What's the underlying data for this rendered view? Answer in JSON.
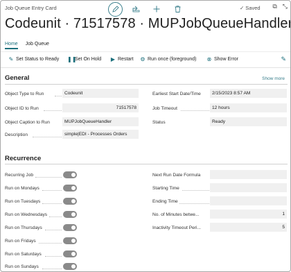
{
  "header": {
    "card_type": "Job Queue Entry Card",
    "title": "Codeunit · 71517578 · MUPJobQueueHandler",
    "saved_label": "Saved",
    "icons": [
      "edit-pencil-icon",
      "share-icon",
      "new-plus-icon",
      "delete-trash-icon",
      "checkmark-icon",
      "open-new-window-icon",
      "collapse-icon"
    ]
  },
  "tabs": [
    {
      "label": "Home",
      "active": true
    },
    {
      "label": "Job Queue",
      "active": false
    }
  ],
  "actions": [
    {
      "label": "Set Status to Ready",
      "icon": "set-status-icon"
    },
    {
      "label": "Set On Hold",
      "icon": "pause-icon"
    },
    {
      "label": "Restart",
      "icon": "play-icon"
    },
    {
      "label": "Run once (foreground)",
      "icon": "run-once-icon"
    },
    {
      "label": "Show Error",
      "icon": "error-icon"
    }
  ],
  "general": {
    "title": "General",
    "show_more": "Show more",
    "fields": [
      {
        "label": "Object Type to Run",
        "value": "Codeunit"
      },
      {
        "label": "Object ID to Run",
        "value": "71517578"
      },
      {
        "label": "Object Caption to Run",
        "value": "MUPJobQueueHandler"
      },
      {
        "label": "Description",
        "value": "simple|EDI - Processes Orders"
      },
      {
        "label": "Earliest Start Date/Time",
        "value": "2/15/2023 8:57 AM"
      },
      {
        "label": "Job Timeout",
        "value": "12 hours"
      },
      {
        "label": "Status",
        "value": "Ready"
      }
    ]
  },
  "recurrence": {
    "title": "Recurrence",
    "toggles": [
      {
        "label": "Recurring Job",
        "on": true
      },
      {
        "label": "Run on Mondays",
        "on": true
      },
      {
        "label": "Run on Tuesdays",
        "on": true
      },
      {
        "label": "Run on Wednesdays",
        "on": true
      },
      {
        "label": "Run on Thursdays",
        "on": true
      },
      {
        "label": "Run on Fridays",
        "on": true
      },
      {
        "label": "Run on Saturdays",
        "on": true
      },
      {
        "label": "Run on Sundays",
        "on": true
      }
    ],
    "right_fields": [
      {
        "label": "Next Run Date Formula",
        "value": ""
      },
      {
        "label": "Starting Time",
        "value": ""
      },
      {
        "label": "Ending Time",
        "value": ""
      },
      {
        "label": "No. of Minutes betwe...",
        "value": "1"
      },
      {
        "label": "Inactivity Timeout Peri...",
        "value": "5"
      }
    ]
  },
  "colors": {
    "accent": "#1b6f7c",
    "toggle": "#8a8a8a",
    "field_bg": "#f0f0f0"
  }
}
